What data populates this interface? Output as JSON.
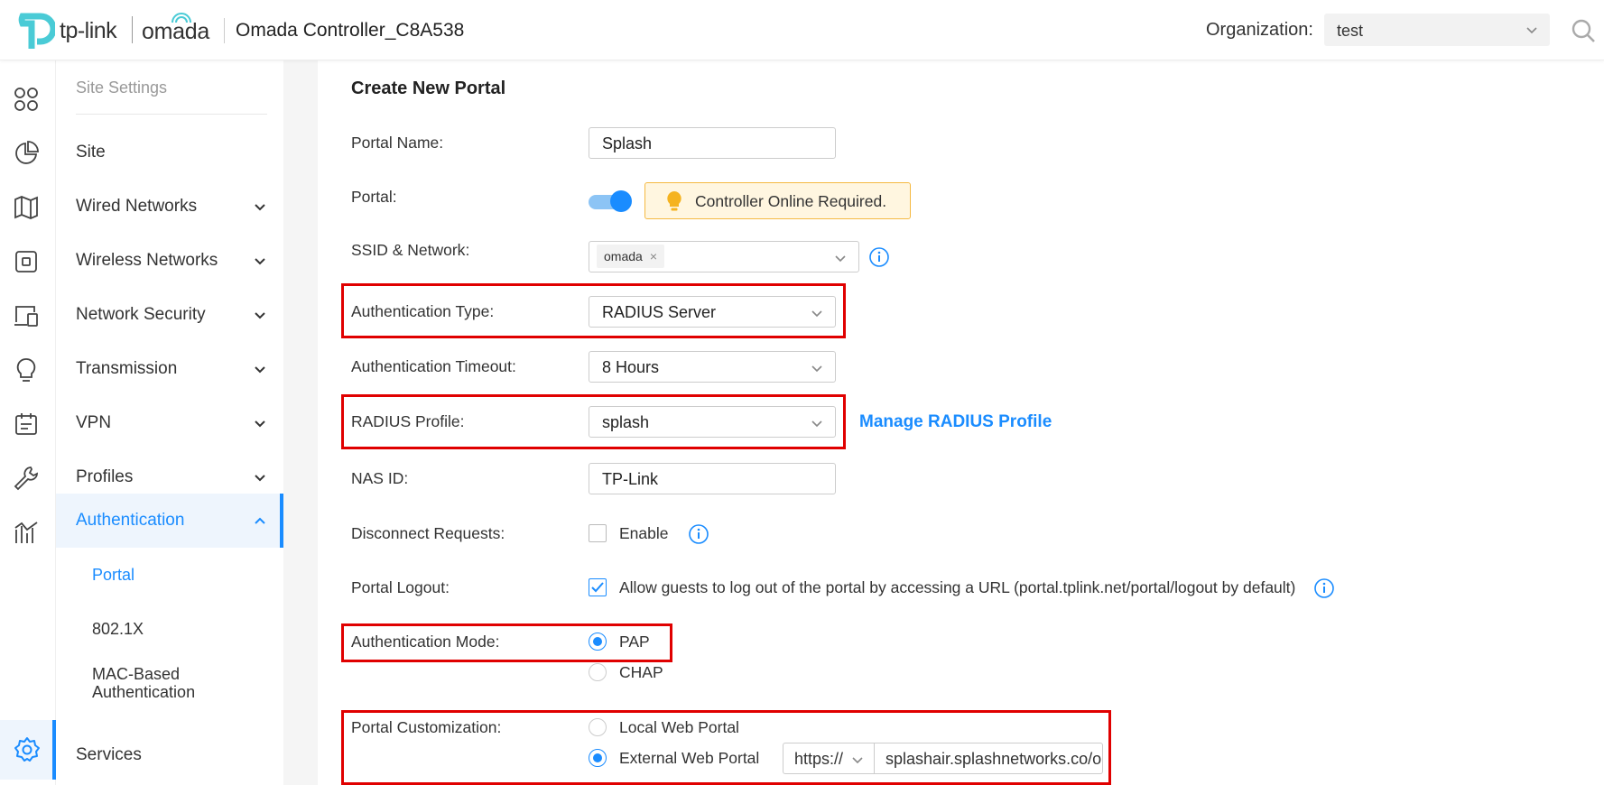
{
  "header": {
    "brand_tp": "tp-link",
    "brand_omada": "omada",
    "app_title": "Omada Controller_C8A538",
    "org_label": "Organization:",
    "org_value": "test"
  },
  "sidebar": {
    "heading": "Site Settings",
    "items": [
      {
        "label": "Site"
      },
      {
        "label": "Wired Networks"
      },
      {
        "label": "Wireless Networks"
      },
      {
        "label": "Network Security"
      },
      {
        "label": "Transmission"
      },
      {
        "label": "VPN"
      },
      {
        "label": "Profiles"
      },
      {
        "label": "Authentication"
      }
    ],
    "sub_items": [
      {
        "label": "Portal"
      },
      {
        "label": "802.1X"
      },
      {
        "label": "MAC-Based Authentication"
      }
    ],
    "services": "Services"
  },
  "form": {
    "title": "Create New Portal",
    "portal_name_label": "Portal Name",
    "portal_name_value": "Splash",
    "portal_label": "Portal",
    "portal_enabled": true,
    "portal_warning": "Controller Online Required.",
    "ssid_label": "SSID & Network",
    "ssid_tag": "omada",
    "auth_type_label": "Authentication Type",
    "auth_type_value": "RADIUS Server",
    "auth_timeout_label": "Authentication Timeout",
    "auth_timeout_value": "8 Hours",
    "radius_profile_label": "RADIUS Profile",
    "radius_profile_value": "splash",
    "manage_radius_link": "Manage RADIUS Profile",
    "nas_id_label": "NAS ID",
    "nas_id_value": "TP-Link",
    "disconnect_label": "Disconnect Requests",
    "disconnect_option": "Enable",
    "logout_label": "Portal Logout",
    "logout_option": "Allow guests to log out of the portal by accessing a URL (portal.tplink.net/portal/logout by default)",
    "auth_mode_label": "Authentication Mode",
    "auth_mode_options": [
      "PAP",
      "CHAP"
    ],
    "auth_mode_selected": "PAP",
    "customization_label": "Portal Customization",
    "customization_options": [
      "Local Web Portal",
      "External Web Portal"
    ],
    "customization_selected": "External Web Portal",
    "url_protocol": "https://",
    "url_value": "splashair.splashnetworks.co/or"
  },
  "colors": {
    "accent": "#1a8cff",
    "highlight_box": "#e00000",
    "warning_bg": "#fff6e0"
  }
}
